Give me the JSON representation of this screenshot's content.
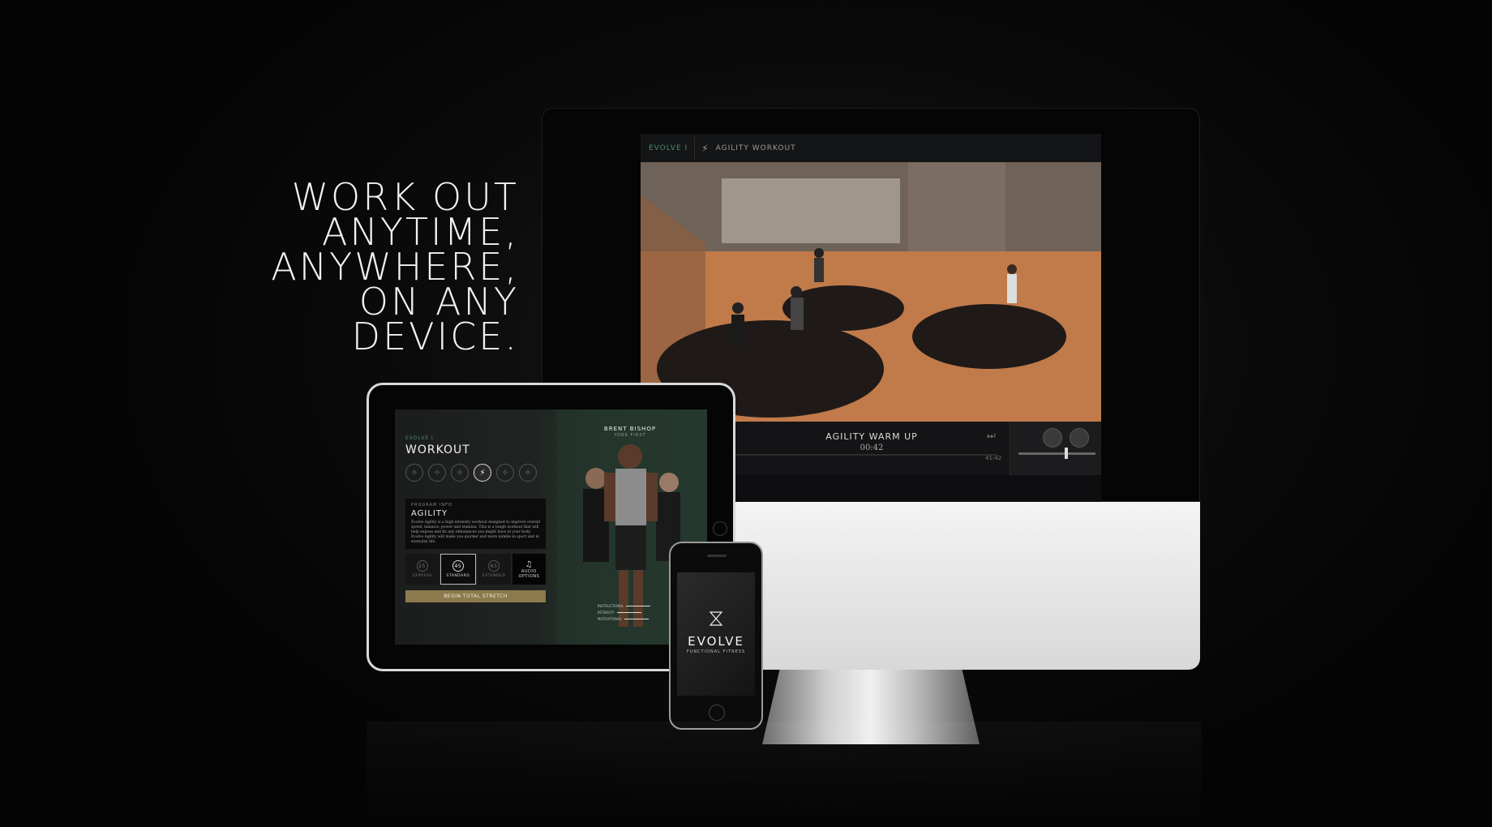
{
  "headline": [
    "WORK OUT",
    "ANYTIME,",
    "ANYWHERE,",
    "ON ANY",
    "DEVICE."
  ],
  "monitor": {
    "brand": "EVOLVE I",
    "workout_title": "AGILITY WORKOUT",
    "now_playing": "AGILITY WARM UP",
    "elapsed": "00:42",
    "total": "41:42",
    "progress_fraction": 0.03,
    "volume_fraction": 0.6
  },
  "tablet": {
    "brand": "EVOLVE I",
    "title": "WORKOUT",
    "trainer_name": "BRENT BISHOP",
    "trainer_sub": "YORK FIRST",
    "info_label": "PROGRAM INFO",
    "info_heading": "AGILITY",
    "info_body": "Evolve Agility is a high intensity workout designed to improve overall speed, balance, power and stamina. This is a tough workout that will help expose and fix any imbalances you might have in your body. Evolve Agility will make you quicker and more nimble in sport and in everyday life.",
    "options": [
      {
        "num": "25",
        "label": "EXPRESS"
      },
      {
        "num": "45",
        "label": "STANDARD",
        "selected": true
      },
      {
        "num": "65",
        "label": "EXTENDED"
      }
    ],
    "audio_label_1": "AUDIO",
    "audio_label_2": "OPTIONS",
    "begin_label": "BEGIN TOTAL STRETCH",
    "meters": [
      "INSTRUCTIONAL",
      "INTENSITY",
      "MOTIVATIONAL"
    ]
  },
  "phone": {
    "app_name": "EVOLVE",
    "app_sub": "FUNCTIONAL FITNESS"
  },
  "colors": {
    "accent_green": "#4f8a6c",
    "begin_button": "#8c7a4d"
  }
}
